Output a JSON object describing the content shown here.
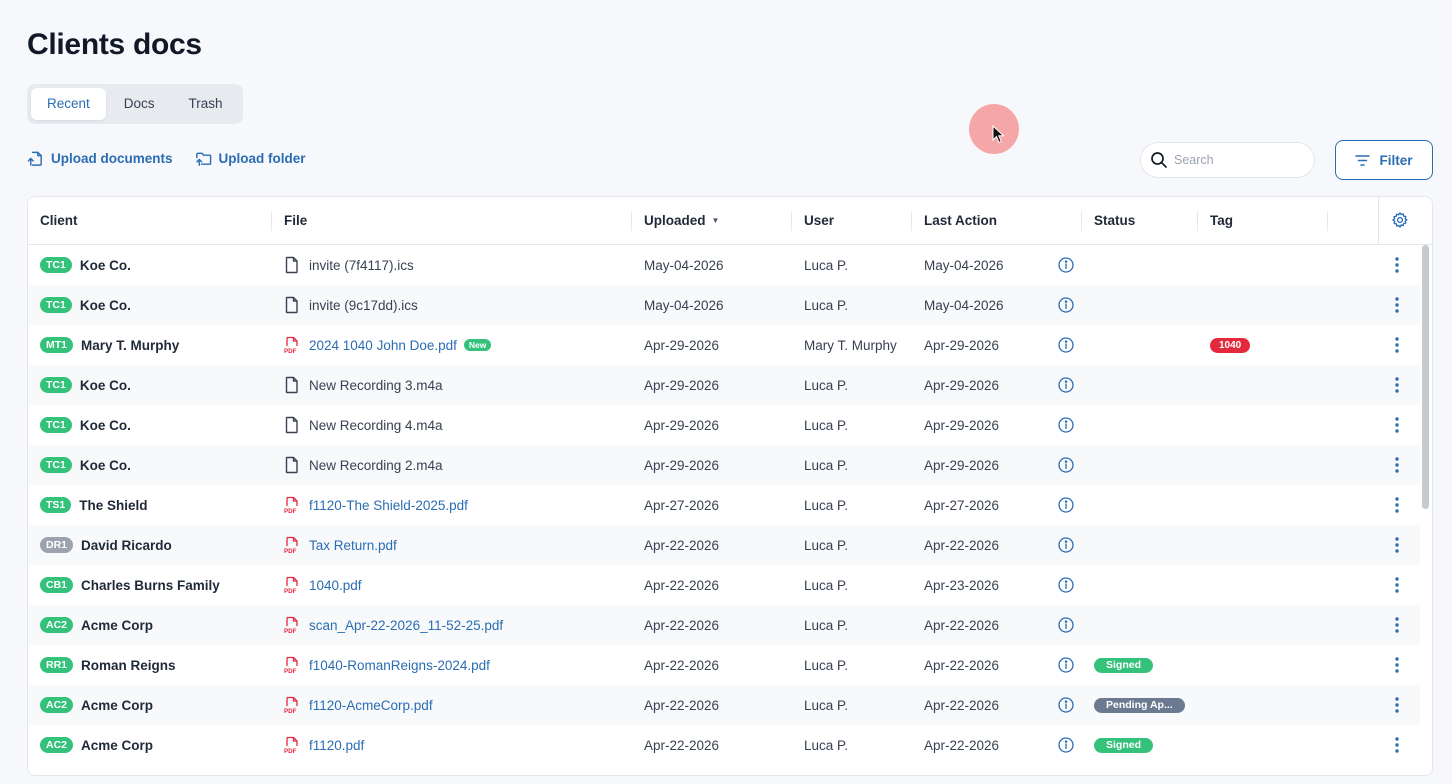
{
  "page": {
    "title": "Clients docs"
  },
  "tabs": [
    {
      "label": "Recent",
      "active": true
    },
    {
      "label": "Docs",
      "active": false
    },
    {
      "label": "Trash",
      "active": false
    }
  ],
  "actions": {
    "upload_documents": "Upload documents",
    "upload_folder": "Upload folder"
  },
  "search": {
    "placeholder": "Search"
  },
  "filter": {
    "label": "Filter"
  },
  "colors": {
    "accent": "#2a6db3",
    "green": "#34c27a",
    "red": "#e5293d",
    "grey_pill": "#6b7a90"
  },
  "table": {
    "headers": {
      "client": "Client",
      "file": "File",
      "uploaded": "Uploaded",
      "user": "User",
      "last_action": "Last Action",
      "status": "Status",
      "tag": "Tag"
    },
    "rows": [
      {
        "badge": "TC1",
        "badge_color": "green",
        "client": "Koe Co.",
        "file": "invite (7f4117).ics",
        "file_type": "generic",
        "new": false,
        "uploaded": "May-04-2026",
        "user": "Luca P.",
        "last_action": "May-04-2026",
        "status": "",
        "tag": ""
      },
      {
        "badge": "TC1",
        "badge_color": "green",
        "client": "Koe Co.",
        "file": "invite (9c17dd).ics",
        "file_type": "generic",
        "new": false,
        "uploaded": "May-04-2026",
        "user": "Luca P.",
        "last_action": "May-04-2026",
        "status": "",
        "tag": ""
      },
      {
        "badge": "MT1",
        "badge_color": "green",
        "client": "Mary T. Murphy",
        "file": "2024 1040 John Doe.pdf",
        "file_type": "pdf",
        "new": true,
        "new_label": "New",
        "uploaded": "Apr-29-2026",
        "user": "Mary T. Murphy",
        "last_action": "Apr-29-2026",
        "status": "",
        "tag": "1040"
      },
      {
        "badge": "TC1",
        "badge_color": "green",
        "client": "Koe Co.",
        "file": "New Recording 3.m4a",
        "file_type": "generic",
        "new": false,
        "uploaded": "Apr-29-2026",
        "user": "Luca P.",
        "last_action": "Apr-29-2026",
        "status": "",
        "tag": ""
      },
      {
        "badge": "TC1",
        "badge_color": "green",
        "client": "Koe Co.",
        "file": "New Recording 4.m4a",
        "file_type": "generic",
        "new": false,
        "uploaded": "Apr-29-2026",
        "user": "Luca P.",
        "last_action": "Apr-29-2026",
        "status": "",
        "tag": ""
      },
      {
        "badge": "TC1",
        "badge_color": "green",
        "client": "Koe Co.",
        "file": "New Recording 2.m4a",
        "file_type": "generic",
        "new": false,
        "uploaded": "Apr-29-2026",
        "user": "Luca P.",
        "last_action": "Apr-29-2026",
        "status": "",
        "tag": ""
      },
      {
        "badge": "TS1",
        "badge_color": "green",
        "client": "The Shield",
        "file": "f1120-The Shield-2025.pdf",
        "file_type": "pdf",
        "new": false,
        "uploaded": "Apr-27-2026",
        "user": "Luca P.",
        "last_action": "Apr-27-2026",
        "status": "",
        "tag": ""
      },
      {
        "badge": "DR1",
        "badge_color": "grey",
        "client": "David Ricardo",
        "file": "Tax Return.pdf",
        "file_type": "pdf",
        "new": false,
        "uploaded": "Apr-22-2026",
        "user": "Luca P.",
        "last_action": "Apr-22-2026",
        "status": "",
        "tag": ""
      },
      {
        "badge": "CB1",
        "badge_color": "green",
        "client": "Charles Burns Family",
        "file": "1040.pdf",
        "file_type": "pdf",
        "new": false,
        "uploaded": "Apr-22-2026",
        "user": "Luca P.",
        "last_action": "Apr-23-2026",
        "status": "",
        "tag": ""
      },
      {
        "badge": "AC2",
        "badge_color": "green",
        "client": "Acme Corp",
        "file": "scan_Apr-22-2026_11-52-25.pdf",
        "file_type": "pdf",
        "new": false,
        "uploaded": "Apr-22-2026",
        "user": "Luca P.",
        "last_action": "Apr-22-2026",
        "status": "",
        "tag": ""
      },
      {
        "badge": "RR1",
        "badge_color": "green",
        "client": "Roman Reigns",
        "file": "f1040-RomanReigns-2024.pdf",
        "file_type": "pdf",
        "new": false,
        "uploaded": "Apr-22-2026",
        "user": "Luca P.",
        "last_action": "Apr-22-2026",
        "status": "Signed",
        "status_color": "green",
        "tag": ""
      },
      {
        "badge": "AC2",
        "badge_color": "green",
        "client": "Acme Corp",
        "file": "f1120-AcmeCorp.pdf",
        "file_type": "pdf",
        "new": false,
        "uploaded": "Apr-22-2026",
        "user": "Luca P.",
        "last_action": "Apr-22-2026",
        "status": "Pending Ap...",
        "status_color": "grey",
        "tag": ""
      },
      {
        "badge": "AC2",
        "badge_color": "green",
        "client": "Acme Corp",
        "file": "f1120.pdf",
        "file_type": "pdf",
        "new": false,
        "uploaded": "Apr-22-2026",
        "user": "Luca P.",
        "last_action": "Apr-22-2026",
        "status": "Signed",
        "status_color": "green",
        "tag": ""
      }
    ]
  }
}
